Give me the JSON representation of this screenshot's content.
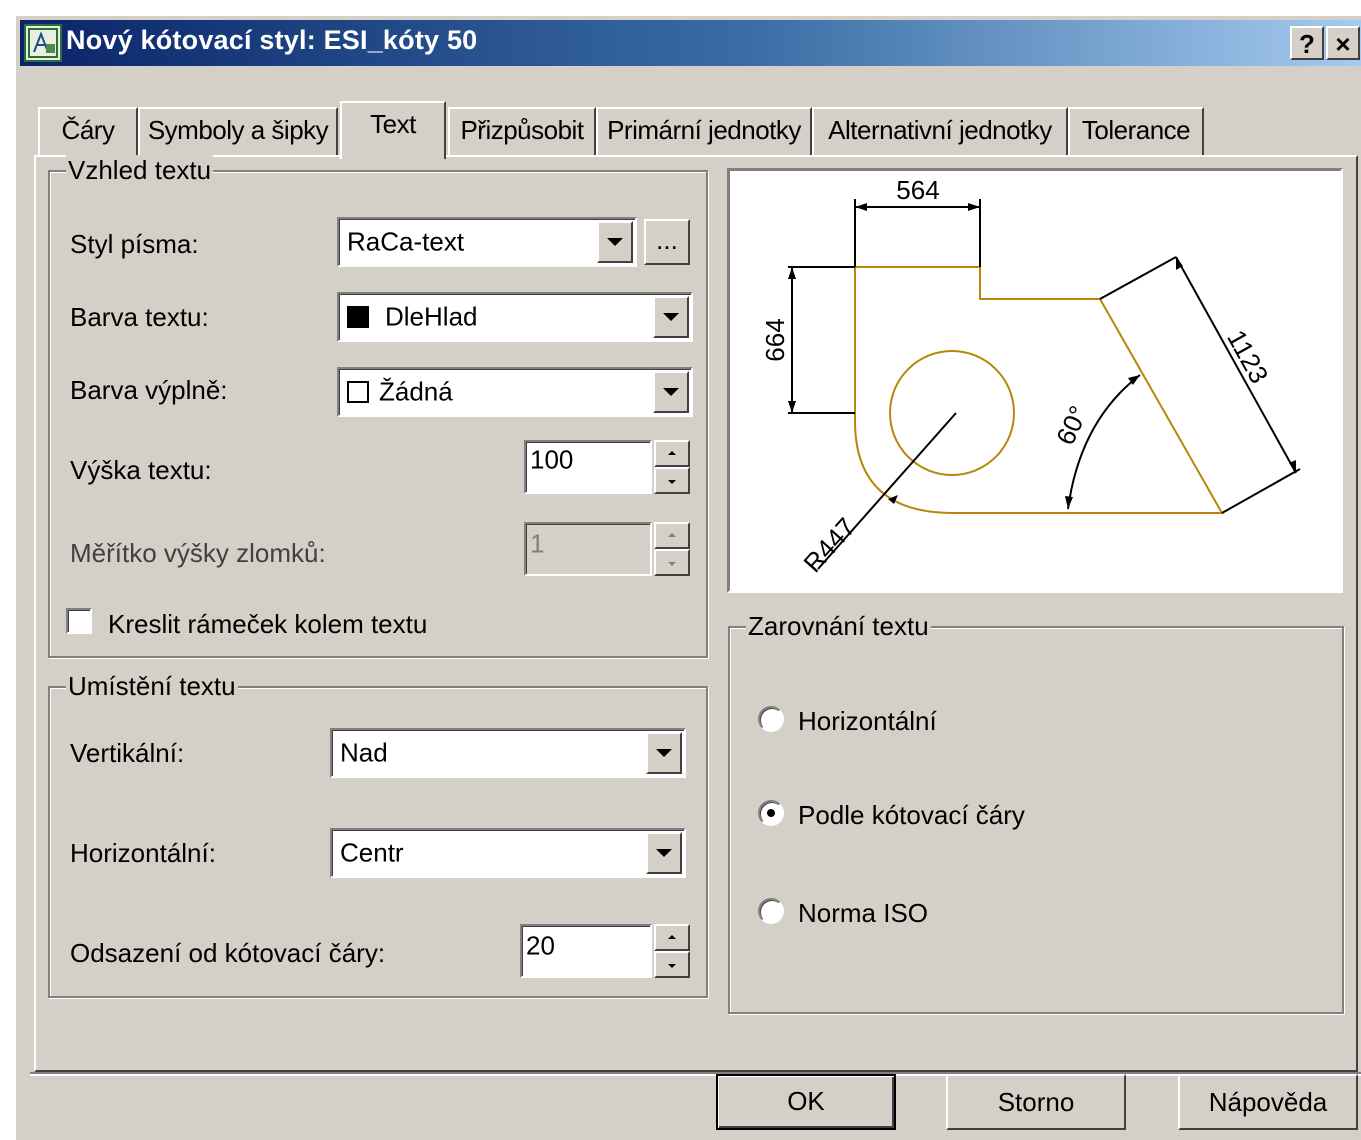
{
  "window": {
    "title": "Nový kótovací styl: ESI_kóty 50",
    "help_button": "?",
    "close_button": "×"
  },
  "tabs": [
    {
      "label": "Čáry",
      "active": false
    },
    {
      "label": "Symboly a šipky",
      "active": false
    },
    {
      "label": "Text",
      "active": true
    },
    {
      "label": "Přizpůsobit",
      "active": false
    },
    {
      "label": "Primární jednotky",
      "active": false
    },
    {
      "label": "Alternativní jednotky",
      "active": false
    },
    {
      "label": "Tolerance",
      "active": false
    }
  ],
  "appearance": {
    "title": "Vzhled textu",
    "text_style_label": "Styl písma:",
    "text_style_value": "RaCa-text",
    "browse_button": "...",
    "text_color_label": "Barva textu:",
    "text_color_value": "DleHlad",
    "fill_color_label": "Barva výplně:",
    "fill_color_value": "Žádná",
    "text_height_label": "Výška textu:",
    "text_height_value": "100",
    "fraction_scale_label": "Měřítko výšky zlomků:",
    "fraction_scale_value": "1",
    "draw_frame_label": "Kreslit rámeček kolem textu",
    "draw_frame_checked": false
  },
  "placement": {
    "title": "Umístění textu",
    "vertical_label": "Vertikální:",
    "vertical_value": "Nad",
    "horizontal_label": "Horizontální:",
    "horizontal_value": "Centr",
    "offset_label": "Odsazení od kótovací čáry:",
    "offset_value": "20"
  },
  "alignment": {
    "title": "Zarovnání textu",
    "options": [
      {
        "label": "Horizontální",
        "selected": false
      },
      {
        "label": "Podle kótovací čáry",
        "selected": true
      },
      {
        "label": "Norma ISO",
        "selected": false
      }
    ]
  },
  "preview": {
    "dim_top": "564",
    "dim_left": "664",
    "dim_slant": "1123",
    "dim_angle": "60°",
    "dim_radius": "R447",
    "geometry_color": "#b8860b"
  },
  "buttons": {
    "ok": "OK",
    "cancel": "Storno",
    "help": "Nápověda"
  }
}
